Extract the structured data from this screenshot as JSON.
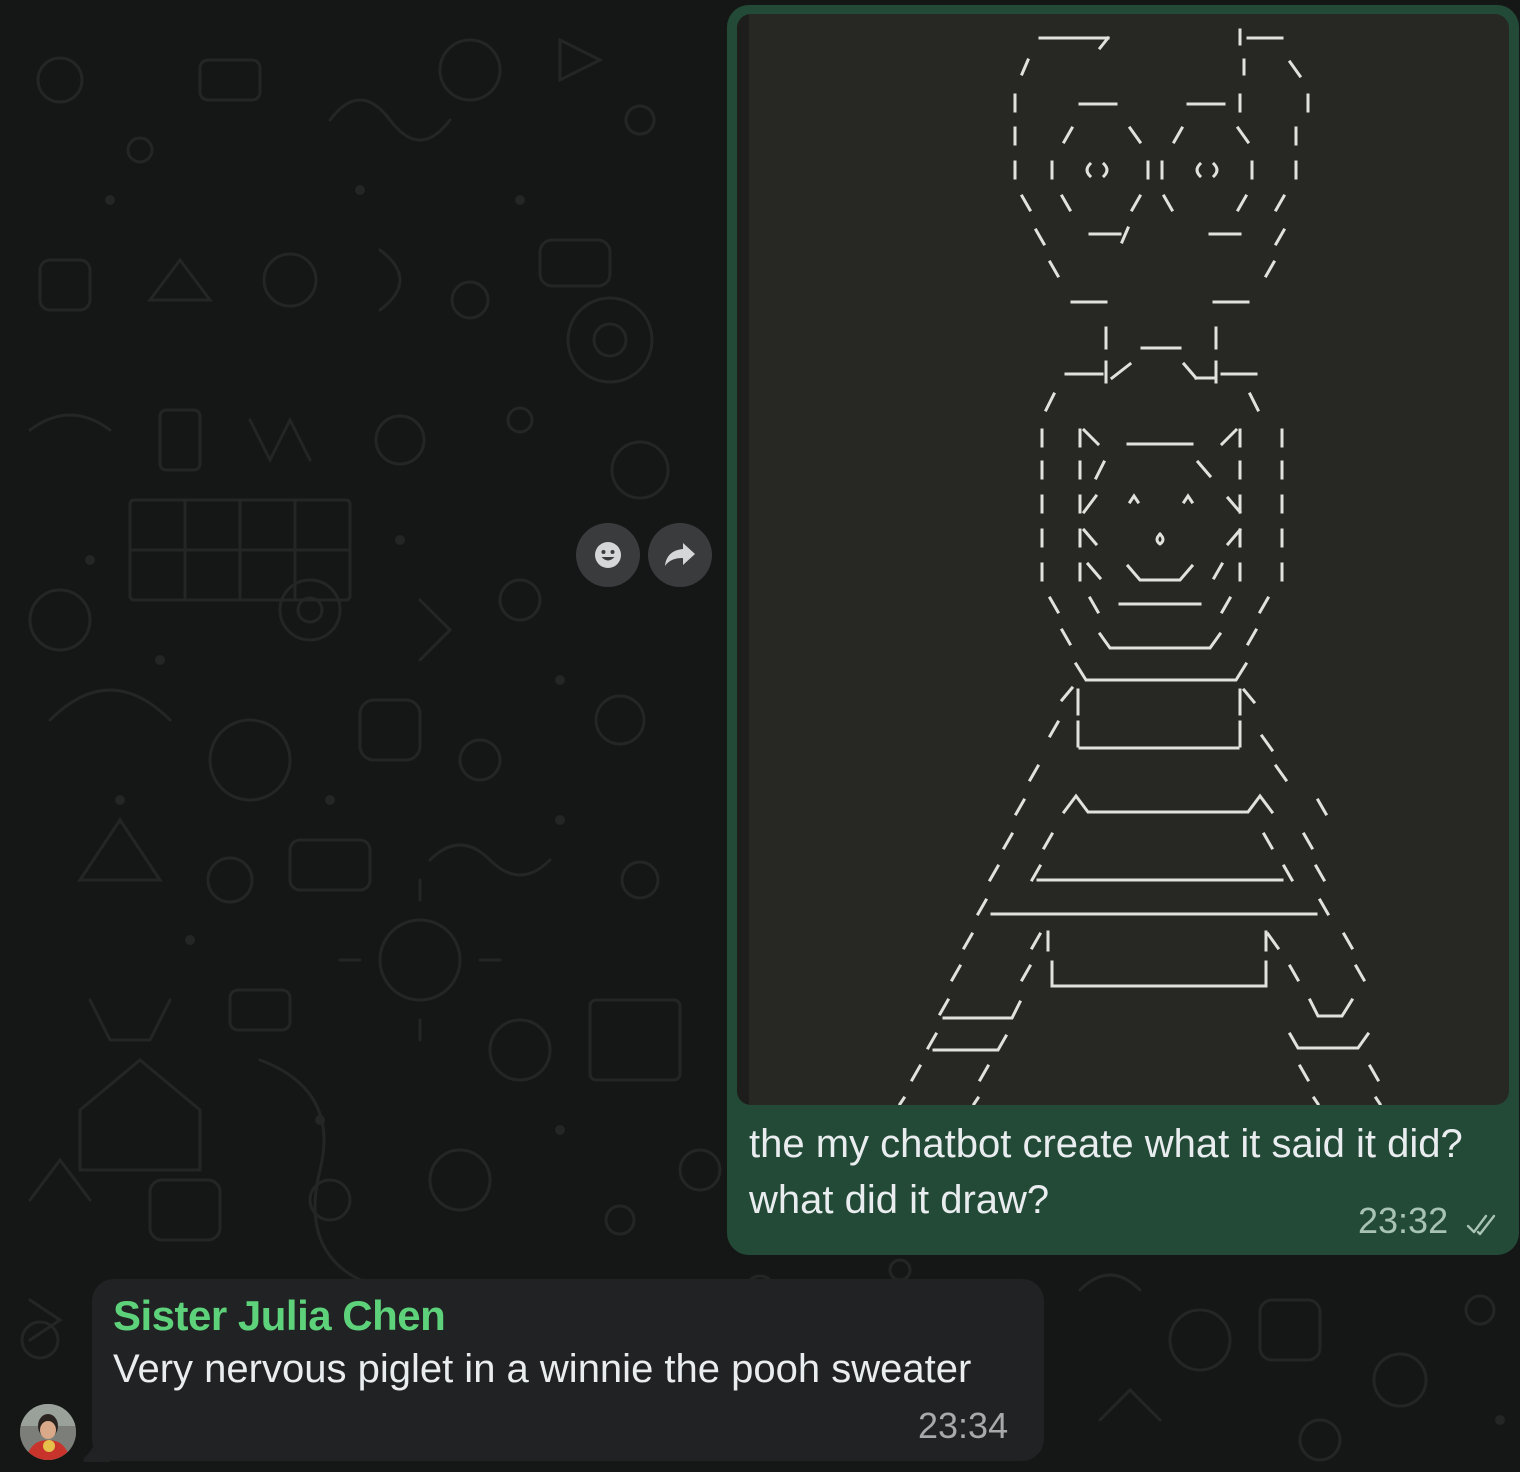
{
  "outgoing_message": {
    "caption": "the my chatbot create what it said it did? what did it draw?",
    "time": "23:32",
    "status_icon": "double-check-icon"
  },
  "hover_actions": {
    "react_icon": "emoji-icon",
    "forward_icon": "forward-arrow-icon"
  },
  "incoming_message": {
    "sender": "Sister Julia Chen",
    "text": "Very nervous piglet in a winnie the pooh sweater",
    "time": "23:34",
    "avatar_icon": "user-avatar"
  },
  "colors": {
    "outgoing_bubble": "#234a36",
    "incoming_bubble": "#202223",
    "sender_name": "#5ed27a",
    "background": "#151616"
  }
}
